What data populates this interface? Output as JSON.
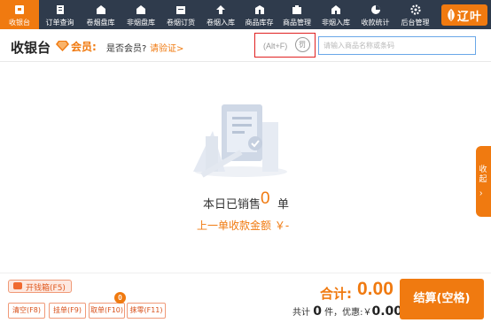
{
  "nav": {
    "items": [
      {
        "label": "收银台",
        "icon": "cashier-icon",
        "active": true
      },
      {
        "label": "订单查询",
        "icon": "order-search-icon"
      },
      {
        "label": "卷烟盘库",
        "icon": "cigarette-inventory-icon"
      },
      {
        "label": "非烟盘库",
        "icon": "non-cigarette-inventory-icon"
      },
      {
        "label": "卷烟订货",
        "icon": "cigarette-order-icon"
      },
      {
        "label": "卷烟入库",
        "icon": "cigarette-stock-in-icon"
      },
      {
        "label": "商品库存",
        "icon": "product-stock-icon"
      },
      {
        "label": "商品管理",
        "icon": "product-manage-icon"
      },
      {
        "label": "非烟入库",
        "icon": "non-cigarette-stock-in-icon"
      },
      {
        "label": "收款统计",
        "icon": "payment-stats-icon"
      },
      {
        "label": "后台管理",
        "icon": "admin-gear-icon"
      }
    ],
    "brand": "辽叶"
  },
  "header": {
    "title": "收银台",
    "member_label": "会员:",
    "member_question": "是否会员?",
    "verify_link": "请验证>",
    "shortcut": "(Alt+F)",
    "scan_glyph": "罚",
    "search_placeholder": "请输入商品名称或条码"
  },
  "main": {
    "sold_prefix": "本日已销售",
    "sold_count": "0",
    "sold_unit": "单",
    "last_amount": "上一单收款金额 ￥-"
  },
  "side_tab": {
    "label": "收起"
  },
  "footer": {
    "cashbox": "开钱箱(F5)",
    "buttons": [
      {
        "label": "清空(F8)"
      },
      {
        "label": "挂单(F9)"
      },
      {
        "label": "取单(F10)"
      },
      {
        "label": "抹零(F11)"
      }
    ],
    "pending_badge": "0",
    "total_label": "合计:",
    "total_value": "0.00",
    "summary_prefix": "共计",
    "summary_count": "0",
    "summary_middle": "件，优惠:",
    "summary_currency": "￥",
    "summary_discount": "0.00",
    "checkout": "结算(空格)"
  },
  "colors": {
    "nav_bg": "#2f3b4c",
    "accent": "#f07a10",
    "alert_border": "#e02020",
    "search_border": "#6aa7e8"
  }
}
